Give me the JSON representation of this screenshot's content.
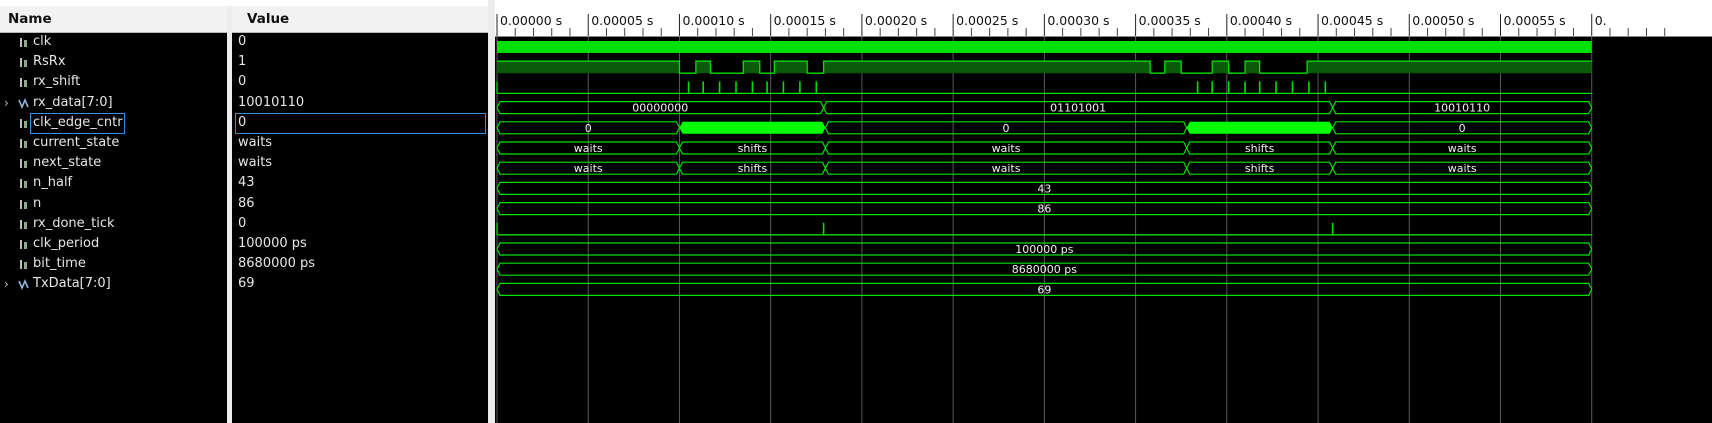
{
  "columns": {
    "name": "Name",
    "value": "Value"
  },
  "signals": [
    {
      "name": "clk",
      "value": "0",
      "kind": "bit",
      "expandable": false
    },
    {
      "name": "RsRx",
      "value": "1",
      "kind": "bit",
      "expandable": false
    },
    {
      "name": "rx_shift",
      "value": "0",
      "kind": "bit",
      "expandable": false
    },
    {
      "name": "rx_data[7:0]",
      "value": "10010110",
      "kind": "bus",
      "expandable": true
    },
    {
      "name": "clk_edge_cntr",
      "value": "0",
      "kind": "bit",
      "expandable": false,
      "selected": true
    },
    {
      "name": "current_state",
      "value": "waits",
      "kind": "bit",
      "expandable": false
    },
    {
      "name": "next_state",
      "value": "waits",
      "kind": "bit",
      "expandable": false
    },
    {
      "name": "n_half",
      "value": "43",
      "kind": "bit",
      "expandable": false
    },
    {
      "name": "n",
      "value": "86",
      "kind": "bit",
      "expandable": false
    },
    {
      "name": "rx_done_tick",
      "value": "0",
      "kind": "bit",
      "expandable": false
    },
    {
      "name": "clk_period",
      "value": "100000 ps",
      "kind": "bit",
      "expandable": false
    },
    {
      "name": "bit_time",
      "value": "8680000 ps",
      "kind": "bit",
      "expandable": false
    },
    {
      "name": "TxData[7:0]",
      "value": "69",
      "kind": "bus",
      "expandable": true
    }
  ],
  "timeline": {
    "unit_label": "s",
    "start_s": 0,
    "end_s": 0.0006,
    "ticks": [
      "0.00000 s",
      "0.00005 s",
      "0.00010 s",
      "0.00015 s",
      "0.00020 s",
      "0.00025 s",
      "0.00030 s",
      "0.00035 s",
      "0.00040 s",
      "0.00045 s",
      "0.00050 s",
      "0.00055 s",
      "0."
    ],
    "tick_values_s": [
      0,
      5e-05,
      0.0001,
      0.00015,
      0.0002,
      0.00025,
      0.0003,
      0.00035,
      0.0004,
      0.00045,
      0.0005,
      0.00055,
      0.0006
    ]
  },
  "waves": [
    {
      "signal": "clk",
      "type": "clock"
    },
    {
      "signal": "RsRx",
      "type": "digital",
      "transitions_s": [
        [
          0,
          1
        ],
        [
          0.0001,
          0
        ],
        [
          0.000109,
          1
        ],
        [
          0.000117,
          0
        ],
        [
          0.000135,
          1
        ],
        [
          0.000144,
          0
        ],
        [
          0.000152,
          1
        ],
        [
          0.00017,
          0
        ],
        [
          0.000179,
          1
        ],
        [
          0.000358,
          0
        ],
        [
          0.000366,
          1
        ],
        [
          0.000375,
          0
        ],
        [
          0.000392,
          1
        ],
        [
          0.000401,
          0
        ],
        [
          0.00041,
          1
        ],
        [
          0.000418,
          0
        ],
        [
          0.000444,
          1
        ]
      ]
    },
    {
      "signal": "rx_shift",
      "type": "pulses",
      "pulses_s": [
        0.000105,
        0.000113,
        0.000122,
        0.000131,
        0.00014,
        0.000148,
        0.000157,
        0.000166,
        0.000175,
        0.000384,
        0.000392,
        0.000401,
        0.00041,
        0.000418,
        0.000427,
        0.000436,
        0.000445,
        0.000454
      ]
    },
    {
      "signal": "rx_data[7:0]",
      "type": "bus",
      "segments": [
        {
          "start_s": 0,
          "end_s": 0.000179,
          "label": "00000000"
        },
        {
          "start_s": 0.000179,
          "end_s": 0.000458,
          "label": "01101001"
        },
        {
          "start_s": 0.000458,
          "end_s": 0.0006,
          "label": "10010110"
        }
      ]
    },
    {
      "signal": "clk_edge_cntr",
      "type": "bus",
      "segments": [
        {
          "start_s": 0,
          "end_s": 0.0001,
          "label": "0"
        },
        {
          "start_s": 0.0001,
          "end_s": 0.00018,
          "label": "",
          "busy": true
        },
        {
          "start_s": 0.00018,
          "end_s": 0.000378,
          "label": "0"
        },
        {
          "start_s": 0.000378,
          "end_s": 0.000458,
          "label": "",
          "busy": true
        },
        {
          "start_s": 0.000458,
          "end_s": 0.0006,
          "label": "0"
        }
      ]
    },
    {
      "signal": "current_state",
      "type": "bus",
      "segments": [
        {
          "start_s": 0,
          "end_s": 0.0001,
          "label": "waits"
        },
        {
          "start_s": 0.0001,
          "end_s": 0.00018,
          "label": "shifts"
        },
        {
          "start_s": 0.00018,
          "end_s": 0.000378,
          "label": "waits"
        },
        {
          "start_s": 0.000378,
          "end_s": 0.000458,
          "label": "shifts"
        },
        {
          "start_s": 0.000458,
          "end_s": 0.0006,
          "label": "waits"
        }
      ]
    },
    {
      "signal": "next_state",
      "type": "bus",
      "segments": [
        {
          "start_s": 0,
          "end_s": 0.0001,
          "label": "waits"
        },
        {
          "start_s": 0.0001,
          "end_s": 0.00018,
          "label": "shifts"
        },
        {
          "start_s": 0.00018,
          "end_s": 0.000378,
          "label": "waits"
        },
        {
          "start_s": 0.000378,
          "end_s": 0.000458,
          "label": "shifts"
        },
        {
          "start_s": 0.000458,
          "end_s": 0.0006,
          "label": "waits"
        }
      ]
    },
    {
      "signal": "n_half",
      "type": "bus",
      "segments": [
        {
          "start_s": 0,
          "end_s": 0.0006,
          "label": "43"
        }
      ]
    },
    {
      "signal": "n",
      "type": "bus",
      "segments": [
        {
          "start_s": 0,
          "end_s": 0.0006,
          "label": "86"
        }
      ]
    },
    {
      "signal": "rx_done_tick",
      "type": "pulses",
      "pulses_s": [
        0.000179,
        0.000458
      ]
    },
    {
      "signal": "clk_period",
      "type": "bus",
      "segments": [
        {
          "start_s": 0,
          "end_s": 0.0006,
          "label": "100000 ps"
        }
      ]
    },
    {
      "signal": "bit_time",
      "type": "bus",
      "segments": [
        {
          "start_s": 0,
          "end_s": 0.0006,
          "label": "8680000 ps"
        }
      ]
    },
    {
      "signal": "TxData[7:0]",
      "type": "bus",
      "segments": [
        {
          "start_s": 0,
          "end_s": 0.0006,
          "label": "69"
        }
      ]
    }
  ],
  "colors": {
    "wave": "#00e000",
    "busy": "#00ff00",
    "grid": "#5a5a5a",
    "selection": "#3b8fd9"
  }
}
